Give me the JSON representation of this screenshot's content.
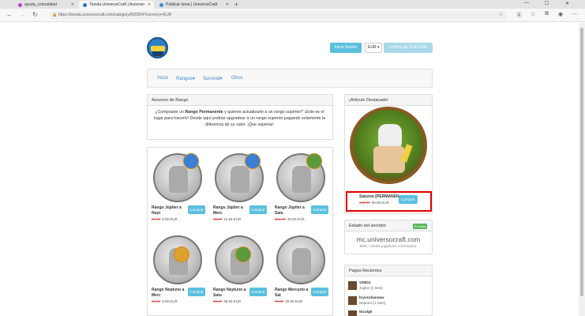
{
  "browser": {
    "tabs": [
      {
        "title": "ayuda_comunidad",
        "color": "#b646c7",
        "active": false
      },
      {
        "title": "Tienda UniversoCraft | Ascenso o...",
        "color": "#2f6fc6",
        "active": true
      },
      {
        "title": "Publicar tema | UniversoCraft",
        "color": "#3a8fd9",
        "active": false
      }
    ],
    "new_tab": "+",
    "url": "https://tienda.universocraft.com/category/655554?currency=EUR"
  },
  "header": {
    "login_label": "Inicia Sesión",
    "currency": "EUR",
    "cart_label": "0 items por 0.00 EUR"
  },
  "nav": {
    "items": [
      "Inicio",
      "Rangos",
      "Survival",
      "Otros"
    ]
  },
  "ascenso": {
    "title": "Ascenso de Rango",
    "text_pre": "¿Compraste un ",
    "text_bold": "Rango Permanente",
    "text_post": " y quieres actualizarlo a un rango superior? ¡Este es el lugar para hacerlo! Desde aquí podrás upgradear a un rango superior pagando solamente la diferencia de su valor. ¡Que esperas!"
  },
  "products": [
    {
      "name": "Rango Júpiter a Nept",
      "old_price": "24.97",
      "price": "5.99",
      "currency": "EUR",
      "buy_label": "Comprar",
      "badge": "#3b7fd6"
    },
    {
      "name": "Rango Júpiter a Merc",
      "old_price": "46.97",
      "price": "15.99",
      "currency": "EUR",
      "buy_label": "Comprar",
      "badge": "#3b7fd6"
    },
    {
      "name": "Rango Júpiter a Satu",
      "old_price": "124.97",
      "price": "49.00",
      "currency": "EUR",
      "buy_label": "Comprar",
      "badge": "#5a9a3a"
    },
    {
      "name": "Rango Neptuno a Merc",
      "old_price": "24.97",
      "price": "9.99",
      "currency": "EUR",
      "buy_label": "Comprar",
      "badge": "#e0a030"
    },
    {
      "name": "Rango Neptuno a Satu",
      "old_price": "98.97",
      "price": "39.99",
      "currency": "EUR",
      "buy_label": "Comprar",
      "badge": "#5a9a3a"
    },
    {
      "name": "Rango Mercurio a Sat",
      "old_price": "76.97",
      "price": "29.99",
      "currency": "EUR",
      "buy_label": "Comprar",
      "badge": ""
    }
  ],
  "featured": {
    "title": "¡Artículo Destacado!",
    "name": "Saturno [PERMANEN",
    "old_price": "149.97",
    "price": "59.99",
    "currency": "EUR",
    "buy_label": "Comprar"
  },
  "server": {
    "title": "Estado del servidor",
    "status": "En línea",
    "address": "mc.universocraft.com",
    "players": "5591 / 20000 jugadores conectados."
  },
  "payments": {
    "title": "Pagos Recientes",
    "items": [
      {
        "user": "V2M24",
        "item": "Júpiter [1 Mes]"
      },
      {
        "user": "brynnzhanowa",
        "item": "Neptuno [1 Mes]"
      },
      {
        "user": "Nicolgh",
        "item": ""
      }
    ]
  }
}
